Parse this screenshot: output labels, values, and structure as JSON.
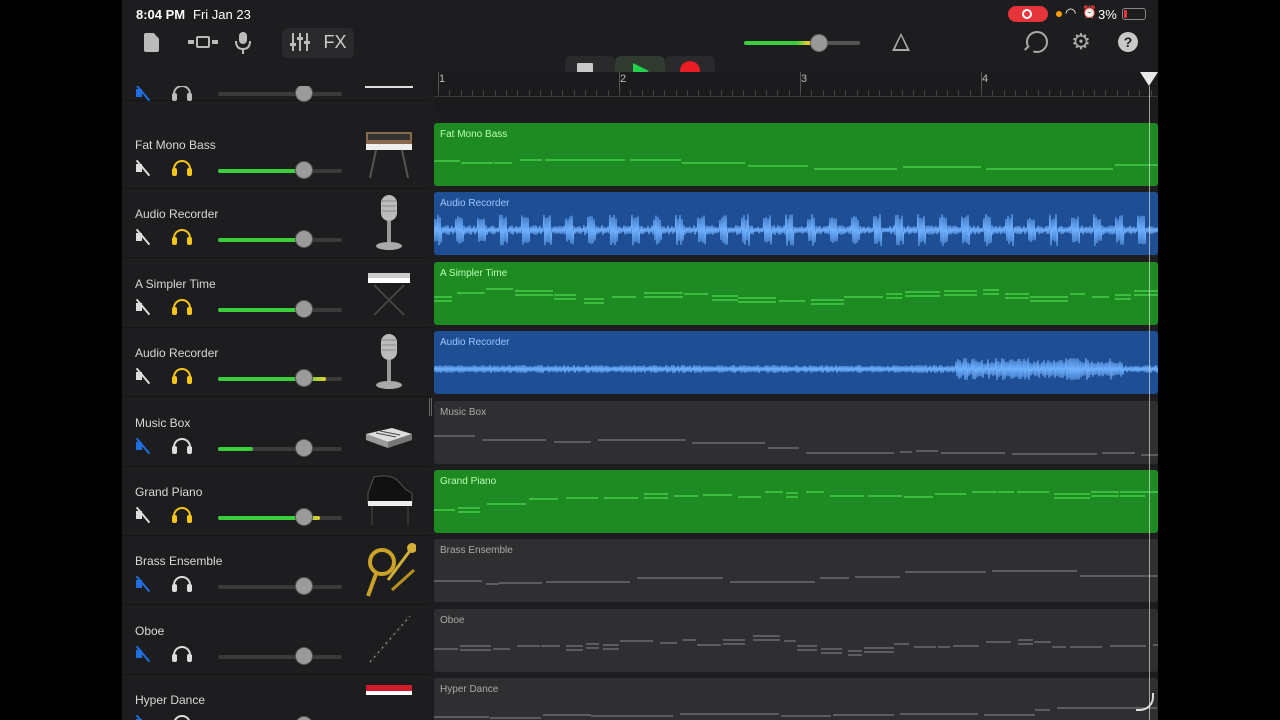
{
  "status_bar": {
    "time": "8:04 PM",
    "date": "Fri Jan 23",
    "battery": "3%"
  },
  "toolbar": {
    "fx_label": "FX",
    "help_label": "?",
    "settings_glyph": "⚙",
    "master_volume": 0.65
  },
  "icons": {
    "document": "document-icon",
    "view": "tracks-view-icon",
    "mic": "microphone-icon",
    "mixer": "mixer-icon",
    "metronome": "metronome-icon",
    "loop": "loop-icon",
    "settings": "settings-icon",
    "help": "help-icon"
  },
  "colors": {
    "midi_region": "#1d8a22",
    "audio_region": "#1e4e93",
    "inactive_region": "#2f2f31",
    "record": "#ec1c24",
    "play": "#23d14a",
    "muted_blue": "#1f6fe0",
    "solo_yellow": "#f5c518"
  },
  "ruler": {
    "bars": [
      "1",
      "2",
      "3",
      "4"
    ]
  },
  "tracks": [
    {
      "name": "Fat Mono Bass",
      "type": "midi",
      "active": true,
      "muted": false,
      "solo": true,
      "volume": 0.69,
      "meter": 0.69,
      "meter_color": "green",
      "instrument": "synth"
    },
    {
      "name": "Audio Recorder",
      "type": "audio",
      "active": true,
      "muted": false,
      "solo": true,
      "volume": 0.69,
      "meter": 0.69,
      "meter_color": "green",
      "instrument": "microphone"
    },
    {
      "name": "A Simpler Time",
      "type": "midi",
      "active": true,
      "muted": false,
      "solo": true,
      "volume": 0.69,
      "meter": 0.69,
      "meter_color": "green",
      "instrument": "keyboard-stand"
    },
    {
      "name": "Audio Recorder",
      "type": "audio",
      "active": true,
      "muted": false,
      "solo": true,
      "volume": 0.69,
      "meter": 0.87,
      "meter_color": "yellow",
      "instrument": "microphone"
    },
    {
      "name": "Music Box",
      "type": "midi",
      "active": false,
      "muted": true,
      "solo": false,
      "volume": 0.69,
      "meter": 0.28,
      "meter_color": "green",
      "instrument": "music-box"
    },
    {
      "name": "Grand Piano",
      "type": "midi",
      "active": true,
      "muted": false,
      "solo": true,
      "volume": 0.69,
      "meter": 0.82,
      "meter_color": "yellow",
      "instrument": "grand-piano"
    },
    {
      "name": "Brass Ensemble",
      "type": "midi",
      "active": false,
      "muted": true,
      "solo": false,
      "volume": 0.69,
      "meter": 0,
      "meter_color": "green",
      "instrument": "brass"
    },
    {
      "name": "Oboe",
      "type": "midi",
      "active": false,
      "muted": true,
      "solo": false,
      "volume": 0.69,
      "meter": 0,
      "meter_color": "green",
      "instrument": "oboe"
    },
    {
      "name": "Hyper Dance",
      "type": "midi",
      "active": false,
      "muted": true,
      "solo": false,
      "volume": 0.69,
      "meter": 0,
      "meter_color": "green",
      "instrument": "red-synth"
    }
  ]
}
